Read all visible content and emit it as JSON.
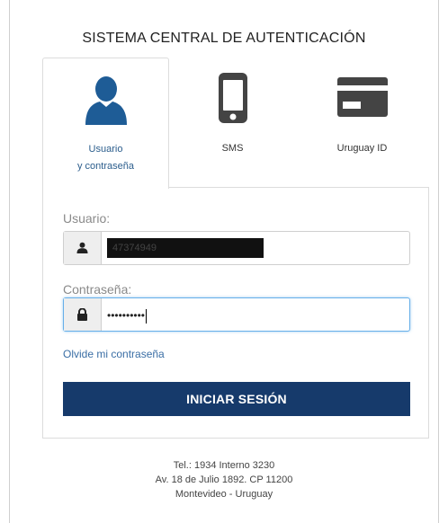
{
  "header": {
    "title": "SISTEMA CENTRAL DE AUTENTICACIÓN"
  },
  "tabs": [
    {
      "id": "usuario",
      "label_line1": "Usuario",
      "label_line2": "y contraseña",
      "icon": "user-icon",
      "active": true
    },
    {
      "id": "sms",
      "label": "SMS",
      "icon": "phone-icon",
      "active": false
    },
    {
      "id": "uruguayid",
      "label": "Uruguay ID",
      "icon": "id-card-icon",
      "active": false
    }
  ],
  "form": {
    "usuario_label": "Usuario:",
    "usuario_value": "47374949",
    "usuario_icon": "user-icon",
    "password_label": "Contraseña:",
    "password_value": "••••••••••",
    "password_icon": "lock-icon",
    "forgot_link": "Olvide mi contraseña",
    "submit_label": "INICIAR SESIÓN"
  },
  "colors": {
    "primary": "#163a6b",
    "link": "#3a6ea5",
    "icon_blue": "#1e5c96"
  },
  "footer": {
    "line1": "Tel.: 1934 Interno 3230",
    "line2": "Av. 18 de Julio 1892. CP 11200",
    "line3": "Montevideo - Uruguay"
  }
}
